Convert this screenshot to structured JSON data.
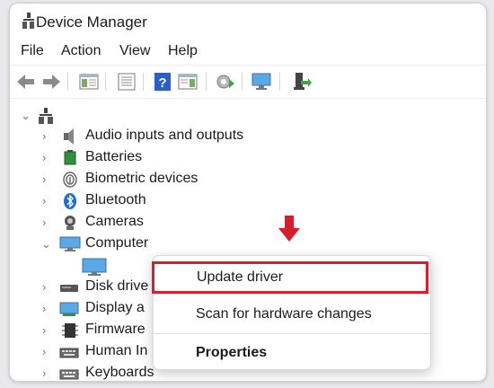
{
  "window": {
    "title": "Device Manager",
    "icon": "computer-tree-icon"
  },
  "menubar": {
    "items": [
      "File",
      "Action",
      "View",
      "Help"
    ]
  },
  "toolbar": {
    "buttons": [
      "back-icon",
      "forward-icon",
      "properties-pane-icon",
      "list-icon",
      "help-icon",
      "action-pane-icon",
      "update-driver-icon",
      "monitor-icon",
      "add-hardware-icon"
    ]
  },
  "tree": {
    "items": [
      {
        "label": "Audio inputs and outputs",
        "icon": "speaker-icon",
        "expanded": false
      },
      {
        "label": "Batteries",
        "icon": "battery-icon",
        "expanded": false
      },
      {
        "label": "Biometric devices",
        "icon": "fingerprint-icon",
        "expanded": false
      },
      {
        "label": "Bluetooth",
        "icon": "bluetooth-icon",
        "expanded": false
      },
      {
        "label": "Cameras",
        "icon": "camera-icon",
        "expanded": false
      },
      {
        "label": "Computer",
        "icon": "monitor-icon",
        "expanded": true
      },
      {
        "label": "Disk drive",
        "icon": "disk-icon",
        "expanded": false
      },
      {
        "label": "Display a",
        "icon": "display-adapter-icon",
        "expanded": false
      },
      {
        "label": "Firmware",
        "icon": "chip-icon",
        "expanded": false
      },
      {
        "label": "Human In",
        "icon": "keyboard-icon",
        "expanded": false
      },
      {
        "label": "Keyboards",
        "icon": "keyboard-icon",
        "expanded": false
      }
    ]
  },
  "context_menu": {
    "items": [
      {
        "label": "Update driver",
        "bold": false,
        "highlighted": true
      },
      {
        "label": "Scan for hardware changes",
        "bold": false,
        "highlighted": false
      },
      {
        "label": "Properties",
        "bold": true,
        "highlighted": false
      }
    ]
  },
  "colors": {
    "highlight": "#d81e2a",
    "accent": "#1a6fd1"
  }
}
